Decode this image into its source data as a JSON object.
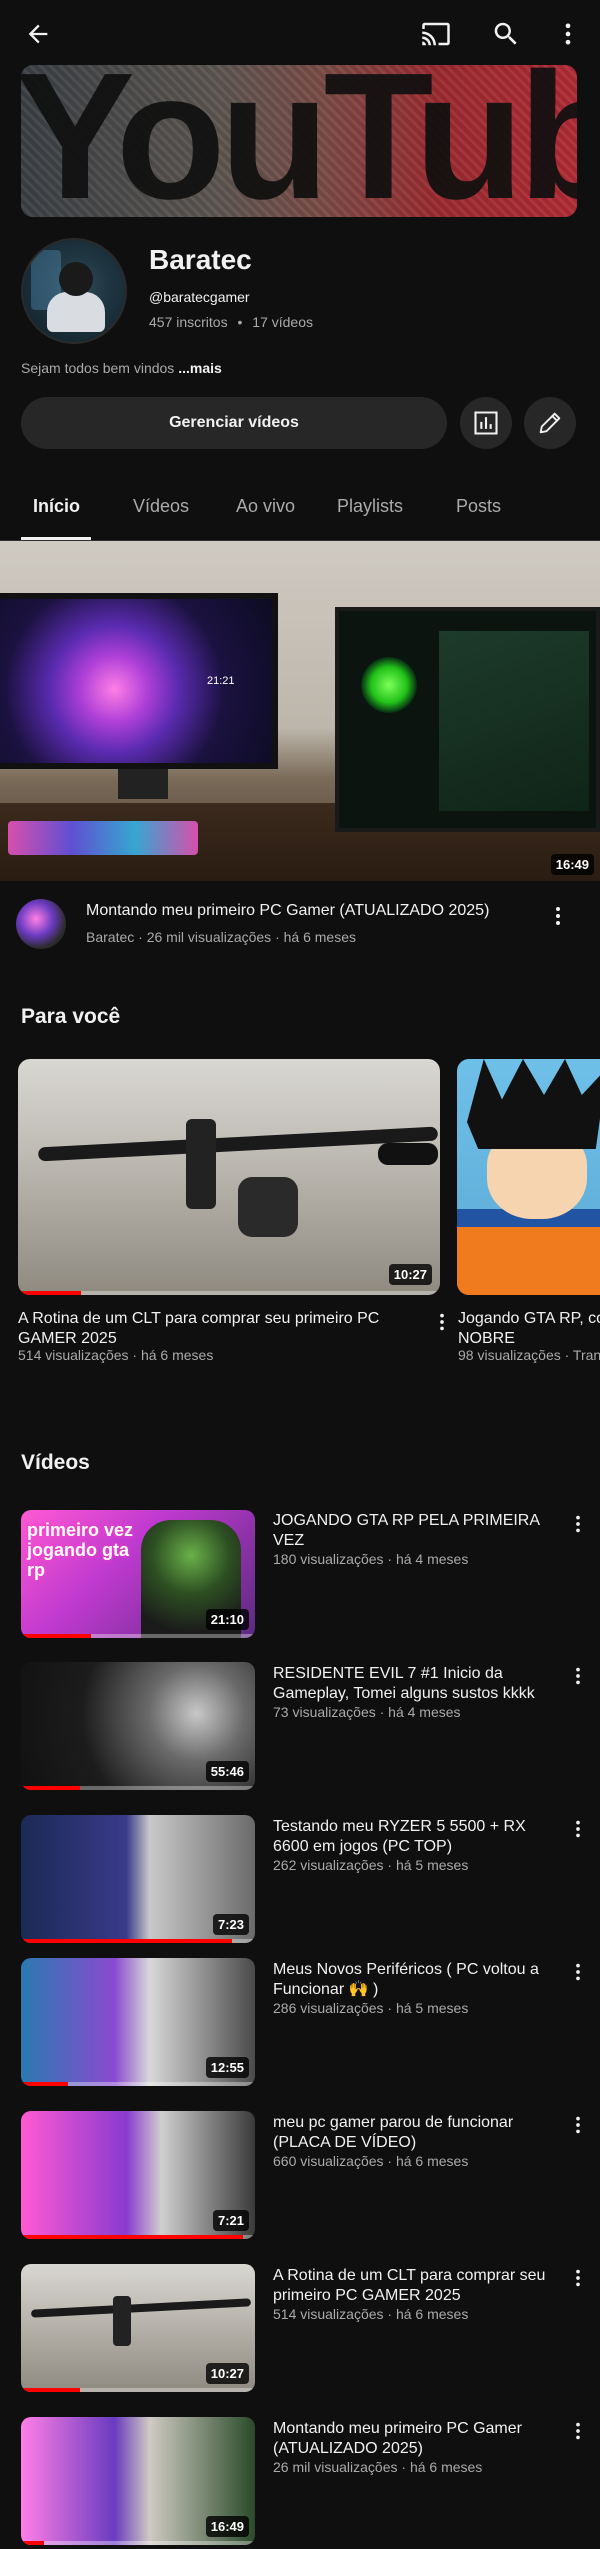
{
  "channel": {
    "name": "Baratec",
    "handle": "@baratecgamer",
    "subscribers": "457 inscritos",
    "separator": "•",
    "video_count": "17 vídeos",
    "description": "Sejam todos bem vindos",
    "more": "...mais",
    "manage_label": "Gerenciar vídeos",
    "banner_text": "YouTube"
  },
  "header": {
    "icons": [
      "back-arrow-icon",
      "cast-icon",
      "search-icon",
      "more-vert-icon"
    ]
  },
  "tabs": [
    {
      "label": "Início",
      "active": true
    },
    {
      "label": "Vídeos"
    },
    {
      "label": "Ao vivo"
    },
    {
      "label": "Playlists"
    },
    {
      "label": "Posts"
    }
  ],
  "featured": {
    "duration": "16:49",
    "clock": "21:21",
    "title": "Montando meu primeiro PC Gamer (ATUALIZADO 2025)",
    "meta": "Baratec · 26 mil visualizações · há 6 meses"
  },
  "for_you": {
    "title": "Para você",
    "items": [
      {
        "title": "A Rotina de um CLT para comprar seu primeiro PC GAMER 2025",
        "meta": "514 visualizações · há 6 meses",
        "duration": "10:27",
        "progress": 0.15
      },
      {
        "title": "Jogando GTA RP, co NOBRE",
        "meta": "98 visualizações · Tran"
      }
    ]
  },
  "videos": {
    "title": "Vídeos",
    "items": [
      {
        "title": "JOGANDO GTA RP PELA PRIMEIRA VEZ",
        "meta": "180 visualizações · há 4 meses",
        "duration": "21:10",
        "thumb_text": "primeiro vez jogando gta rp",
        "progress": 0.3
      },
      {
        "title": "RESIDENTE EVIL 7 #1 Inicio da Gameplay, Tomei alguns sustos kkkk",
        "meta": "73 visualizações · há 4 meses",
        "duration": "55:46",
        "progress": 0.25
      },
      {
        "title": "Testando meu RYZER 5 5500 + RX 6600 em jogos (PC TOP)",
        "meta": "262 visualizações · há 5 meses",
        "duration": "7:23",
        "progress": 0.9
      },
      {
        "title": "Meus Novos Periféricos ( PC voltou a Funcionar 🙌 )",
        "meta": "286 visualizações · há 5 meses",
        "duration": "12:55",
        "progress": 0.2
      },
      {
        "title": "meu pc gamer parou de funcionar (PLACA DE VÍDEO)",
        "meta": "660 visualizações · há 6 meses",
        "duration": "7:21",
        "progress": 0.95
      },
      {
        "title": "A Rotina de um CLT para comprar seu primeiro PC GAMER 2025",
        "meta": "514 visualizações · há 6 meses",
        "duration": "10:27",
        "progress": 0.25
      },
      {
        "title": "Montando meu primeiro PC Gamer (ATUALIZADO 2025)",
        "meta": "26 mil visualizações · há 6 meses",
        "duration": "16:49",
        "progress": 0.1
      }
    ]
  },
  "colors": {
    "background": "#0f0f0f",
    "surface": "#272727",
    "text": "#f1f1f1",
    "secondary": "#aaaaaa",
    "progress": "#ff0000"
  }
}
